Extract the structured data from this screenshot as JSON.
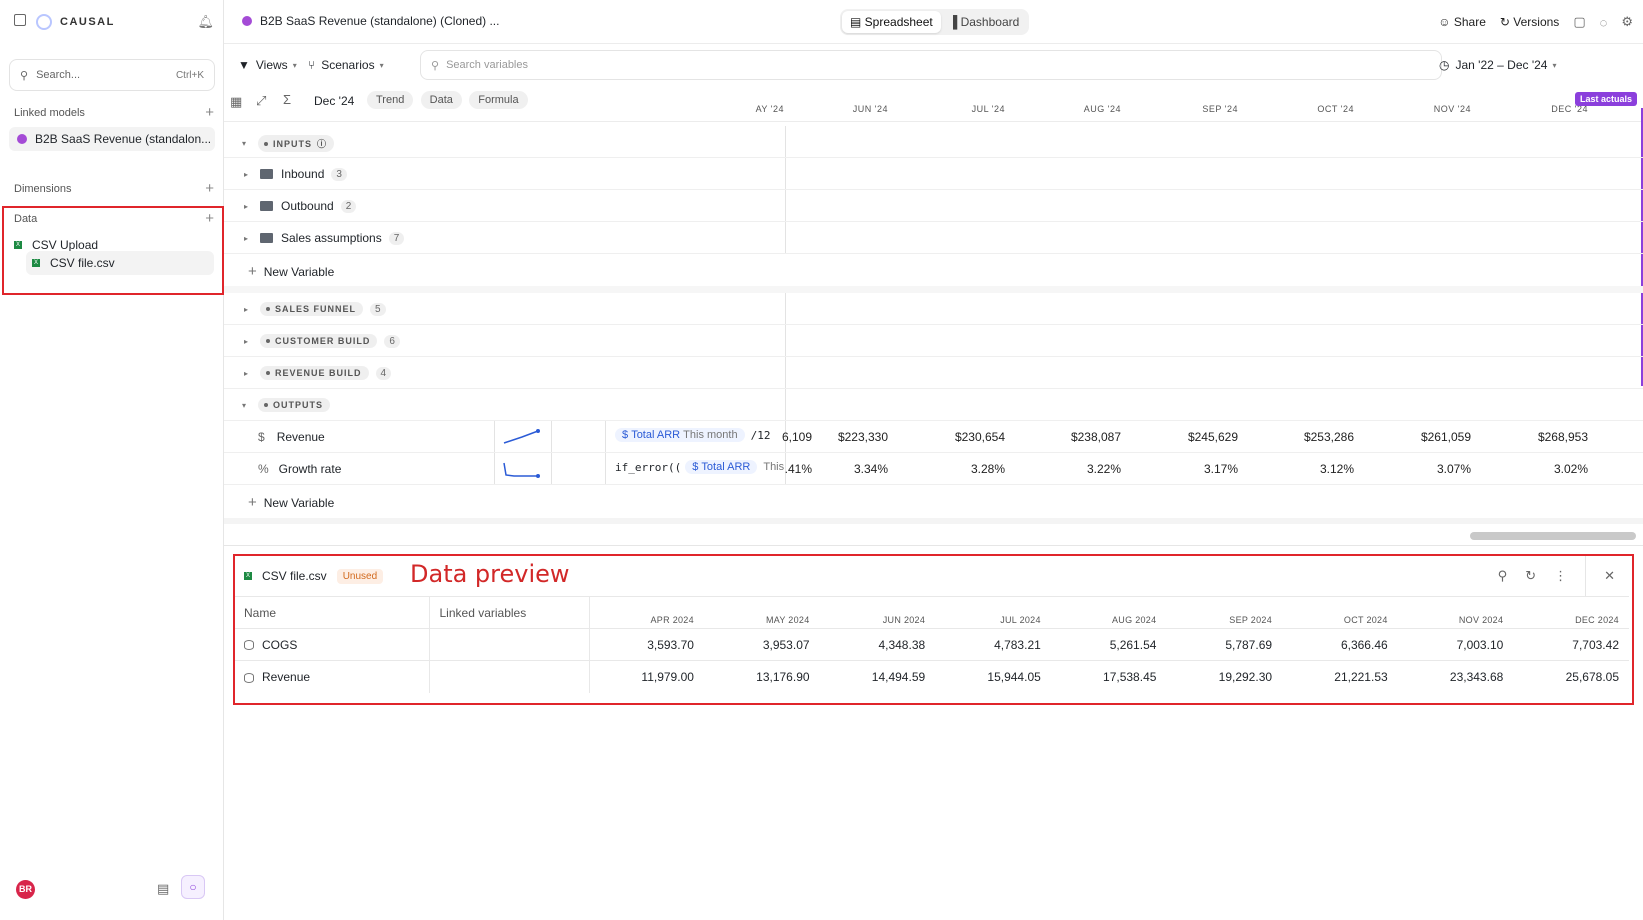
{
  "sidebar": {
    "brand": "CAUSAL",
    "search_placeholder": "Search...",
    "search_shortcut": "Ctrl+K",
    "linked_models_label": "Linked models",
    "linked_model_name": "B2B SaaS Revenue (standalon...",
    "dimensions_label": "Dimensions",
    "data_label": "Data",
    "data_items": [
      {
        "label": "CSV Upload"
      },
      {
        "label": "CSV file.csv"
      }
    ],
    "avatar": "BR"
  },
  "topbar": {
    "doc_title": "B2B SaaS Revenue (standalone) (Cloned) ...",
    "tab_spreadsheet": "Spreadsheet",
    "tab_dashboard": "Dashboard",
    "share": "Share",
    "versions": "Versions"
  },
  "toolbar": {
    "views": "Views",
    "scenarios": "Scenarios",
    "search_placeholder": "Search variables",
    "date_range": "Jan '22 – Dec '24"
  },
  "gridhead": {
    "date": "Dec '24",
    "pills": [
      "Trend",
      "Data",
      "Formula"
    ],
    "months": [
      "AY '24",
      "JUN '24",
      "JUL '24",
      "AUG '24",
      "SEP '24",
      "OCT '24",
      "NOV '24",
      "DEC '24"
    ],
    "last_actuals": "Last actuals"
  },
  "rows": {
    "inputs": "INPUTS",
    "inbound": {
      "label": "Inbound",
      "count": "3"
    },
    "outbound": {
      "label": "Outbound",
      "count": "2"
    },
    "sales_assumptions": {
      "label": "Sales assumptions",
      "count": "7"
    },
    "new_variable": "New Variable",
    "sales_funnel": {
      "label": "SALES FUNNEL",
      "count": "5"
    },
    "customer_build": {
      "label": "CUSTOMER BUILD",
      "count": "6"
    },
    "revenue_build": {
      "label": "REVENUE BUILD",
      "count": "4"
    },
    "outputs": "OUTPUTS",
    "revenue": {
      "label": "Revenue",
      "formula_chip": "Total ARR",
      "formula_mid": "This month",
      "formula_end": "/12",
      "values": [
        "6,109",
        "$223,330",
        "$230,654",
        "$238,087",
        "$245,629",
        "$253,286",
        "$261,059",
        "$268,953"
      ]
    },
    "growth": {
      "label": "Growth rate",
      "formula_start": "if_error((",
      "formula_chip": "Total ARR",
      "formula_end": "This",
      "values": [
        ".41%",
        "3.34%",
        "3.28%",
        "3.22%",
        "3.17%",
        "3.12%",
        "3.07%",
        "3.02%"
      ]
    }
  },
  "preview": {
    "file": "CSV file.csv",
    "badge": "Unused",
    "annotation": "Data preview",
    "col_name": "Name",
    "col_linked": "Linked variables",
    "months": [
      "APR 2024",
      "MAY 2024",
      "JUN 2024",
      "JUL 2024",
      "AUG 2024",
      "SEP 2024",
      "OCT 2024",
      "NOV 2024",
      "DEC 2024"
    ],
    "rows": [
      {
        "name": "COGS",
        "values": [
          "3,593.70",
          "3,953.07",
          "4,348.38",
          "4,783.21",
          "5,261.54",
          "5,787.69",
          "6,366.46",
          "7,003.10",
          "7,703.42"
        ]
      },
      {
        "name": "Revenue",
        "values": [
          "11,979.00",
          "13,176.90",
          "14,494.59",
          "15,944.05",
          "17,538.45",
          "19,292.30",
          "21,221.53",
          "23,343.68",
          "25,678.05"
        ]
      }
    ]
  },
  "colors": {
    "accent": "#8b3fdc",
    "annotation": "#e0252b",
    "excel": "#1d8a43"
  }
}
